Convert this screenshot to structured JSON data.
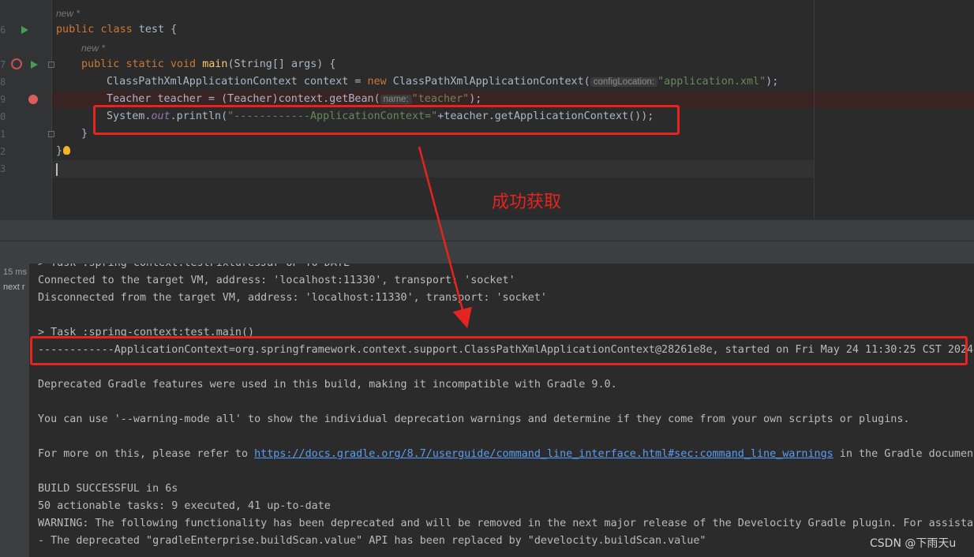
{
  "editor": {
    "line_numbers": [
      "6",
      "7",
      "8",
      "9",
      "0",
      "1",
      "2",
      "3"
    ],
    "usage_hint": "new *",
    "code": {
      "l6": {
        "kw1": "public",
        "kw2": "class",
        "rest": " test {"
      },
      "l7": {
        "kw1": "public",
        "kw2": "static",
        "kw3": "void",
        "fn": "main",
        "rest": "(String[] args) {"
      },
      "l8": {
        "p1": "ClassPathXmlApplicationContext context = ",
        "kw": "new",
        "p2": " ClassPathXmlApplicationContext(",
        "hint": "configLocation:",
        "str": "\"application.xml\"",
        "p3": ");"
      },
      "l9": {
        "p1": "Teacher teacher = (Teacher)context.getBean(",
        "hint": "name:",
        "str": "\"teacher\"",
        "p3": ");"
      },
      "l10": {
        "p1": "System.",
        "fld": "out",
        "p2": ".println(",
        "str": "\"------------ApplicationContext=\"",
        "p3": "+teacher.getApplicationContext());"
      },
      "l11": "}",
      "l12": "}"
    }
  },
  "console": {
    "left_panel": {
      "time": "15 ms",
      "label": "next r"
    },
    "lines": [
      "> Task :spring-context:testFixturesJar UP-TO-DATE",
      "Connected to the target VM, address: 'localhost:11330', transport: 'socket'",
      "Disconnected from the target VM, address: 'localhost:11330', transport: 'socket'",
      "",
      "> Task :spring-context:test.main()",
      "------------ApplicationContext=org.springframework.context.support.ClassPathXmlApplicationContext@28261e8e, started on Fri May 24 11:30:25 CST 2024",
      "",
      "Deprecated Gradle features were used in this build, making it incompatible with Gradle 9.0.",
      "",
      "You can use '--warning-mode all' to show the individual deprecation warnings and determine if they come from your own scripts or plugins.",
      "",
      "",
      "",
      "BUILD SUCCESSFUL in 6s",
      "50 actionable tasks: 9 executed, 41 up-to-date",
      "WARNING: The following functionality has been deprecated and will be removed in the next major release of the Develocity Gradle plugin. For assistance",
      "- The deprecated \"gradleEnterprise.buildScan.value\" API has been replaced by \"develocity.buildScan.value\""
    ],
    "more_info": {
      "prefix": "For more on this, please refer to ",
      "link": "https://docs.gradle.org/8.7/userguide/command_line_interface.html#sec:command_line_warnings",
      "suffix": " in the Gradle documentation."
    }
  },
  "annotation": {
    "text": "成功获取"
  },
  "watermark": "CSDN @下雨天u",
  "colors": {
    "annotation_red": "#e52420",
    "keyword": "#cc7832",
    "string": "#6a8759",
    "method": "#ffc66d",
    "field": "#9876aa",
    "link": "#589df6"
  }
}
